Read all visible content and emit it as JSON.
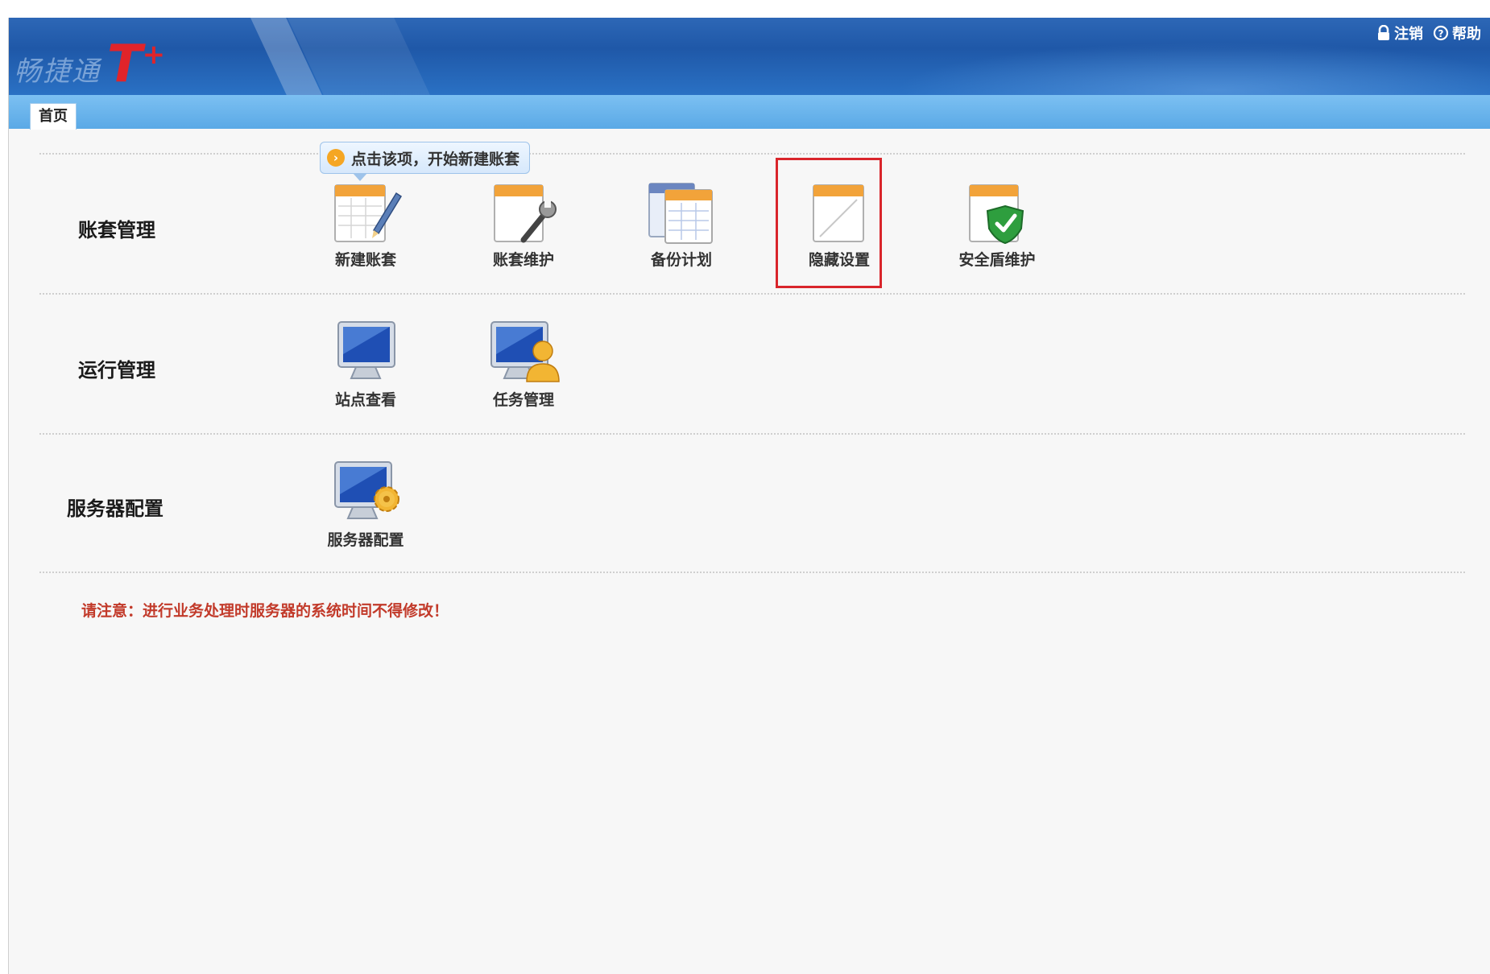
{
  "header": {
    "logo_text": "畅捷通",
    "logo_brand": "T",
    "logo_plus": "+",
    "links": [
      {
        "label": "注销",
        "icon": "lock-icon"
      },
      {
        "label": "帮助",
        "icon": "help-icon"
      }
    ]
  },
  "tabs": [
    {
      "label": "首页"
    }
  ],
  "tooltip": {
    "text": "点击该项，开始新建账套"
  },
  "sections": [
    {
      "label": "账套管理",
      "items": [
        {
          "label": "新建账套",
          "icon": "new-account-icon"
        },
        {
          "label": "账套维护",
          "icon": "account-maintenance-icon"
        },
        {
          "label": "备份计划",
          "icon": "backup-plan-icon"
        },
        {
          "label": "隐藏设置",
          "icon": "hidden-settings-icon",
          "highlighted": true
        },
        {
          "label": "安全盾维护",
          "icon": "security-shield-icon"
        }
      ]
    },
    {
      "label": "运行管理",
      "items": [
        {
          "label": "站点查看",
          "icon": "site-view-icon"
        },
        {
          "label": "任务管理",
          "icon": "task-management-icon"
        }
      ]
    },
    {
      "label": "服务器配置",
      "items": [
        {
          "label": "服务器配置",
          "icon": "server-config-icon"
        }
      ]
    }
  ],
  "notice": "请注意：进行业务处理时服务器的系统时间不得修改！",
  "colors": {
    "header": "#2460b0",
    "tabbar": "#6cb6ec",
    "highlight": "#d9252b",
    "notice": "#c23a2a"
  }
}
